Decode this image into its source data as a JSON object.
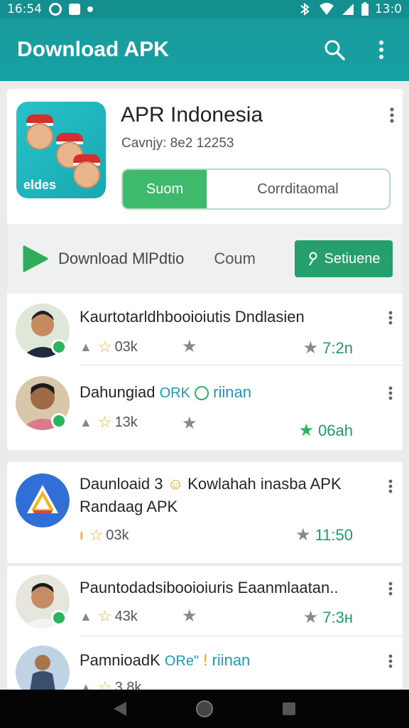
{
  "status": {
    "time": "16:54",
    "battery": "13:0"
  },
  "header": {
    "title": "Download APK",
    "search_icon": "search-icon",
    "menu_icon": "more-vert-icon"
  },
  "hero": {
    "logo_text": "eldes",
    "title": "APR Indonesia",
    "subtitle": "Cavnjy: 8e2 12253",
    "segment_active": "Suom",
    "segment_inactive": "Corrditaomal"
  },
  "action_strip": {
    "download_label": "Download MlPdtio",
    "count_label": "Coum",
    "button_label": "Setiuene",
    "button_icon": "pin-icon"
  },
  "list": [
    {
      "title": "Kaurtotarldhbooioiutis Dndlasien",
      "icon_text": "",
      "rating_count": "03k",
      "right_value": "7:2n",
      "right_star": "gray"
    },
    {
      "title": "Dahungiad",
      "title_tag": "ORK",
      "title_tail": "riinan",
      "rating_count": "13k",
      "right_value": "06ah",
      "right_star": "green"
    },
    {
      "title": "Daunloaid 3",
      "title_tail": "Kowlahah inasba APK",
      "title_line2": "Randaag APK",
      "rating_count": "03k",
      "right_value": "11:50",
      "right_star": "gray"
    },
    {
      "title": "Pauntodadsibooioiuris Eaanmlaatan..",
      "rating_count": "43k",
      "right_value": "7:3н",
      "right_star": "gray"
    },
    {
      "title": "PamnioadK",
      "title_tag": "ORe\"",
      "title_tail": "riinan",
      "rating_count": "3.8k",
      "right_value": "",
      "right_star": "gray"
    }
  ],
  "colors": {
    "primary": "#16a0a4",
    "accent_green": "#3dba6c",
    "star_gold": "#e7b43a"
  }
}
